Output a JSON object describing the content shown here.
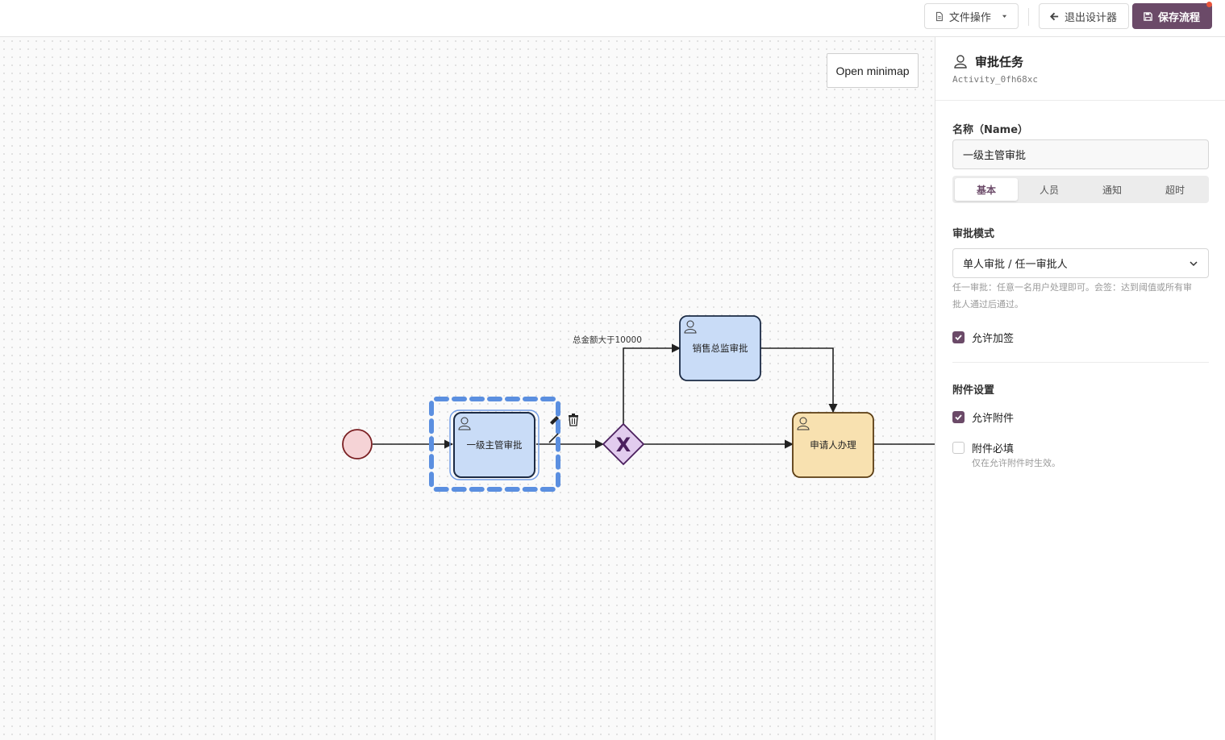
{
  "toolbar": {
    "file_ops_label": "文件操作",
    "exit_label": "退出设计器",
    "save_label": "保存流程",
    "save_color": "#6b4a68"
  },
  "canvas": {
    "minimap_label": "Open minimap",
    "tasks": {
      "level1": "一级主管审批",
      "sales": "销售总监审批",
      "applicant": "申请人办理"
    },
    "gateway_symbol": "X",
    "condition_label": "总金额大于10000"
  },
  "panel": {
    "title": "审批任务",
    "element_id": "Activity_0fh68xc",
    "name_label": "名称（Name）",
    "name_value": "一级主管审批",
    "tabs": [
      {
        "label": "基本",
        "active": true
      },
      {
        "label": "人员",
        "active": false
      },
      {
        "label": "通知",
        "active": false
      },
      {
        "label": "超时",
        "active": false
      }
    ],
    "mode_label": "审批模式",
    "mode_value": "单人审批 / 任一审批人",
    "mode_hint_line1": "任一审批：任意一名用户处理即可。会签：达到阈值或所有审",
    "mode_hint_line2": "批人通过后通过。",
    "allow_add_sign": {
      "label": "允许加签",
      "checked": true
    },
    "attachment_section": "附件设置",
    "allow_attachment": {
      "label": "允许附件",
      "checked": true
    },
    "attachment_required": {
      "label": "附件必填",
      "checked": false
    },
    "attachment_hint": "仅在允许附件时生效。"
  }
}
